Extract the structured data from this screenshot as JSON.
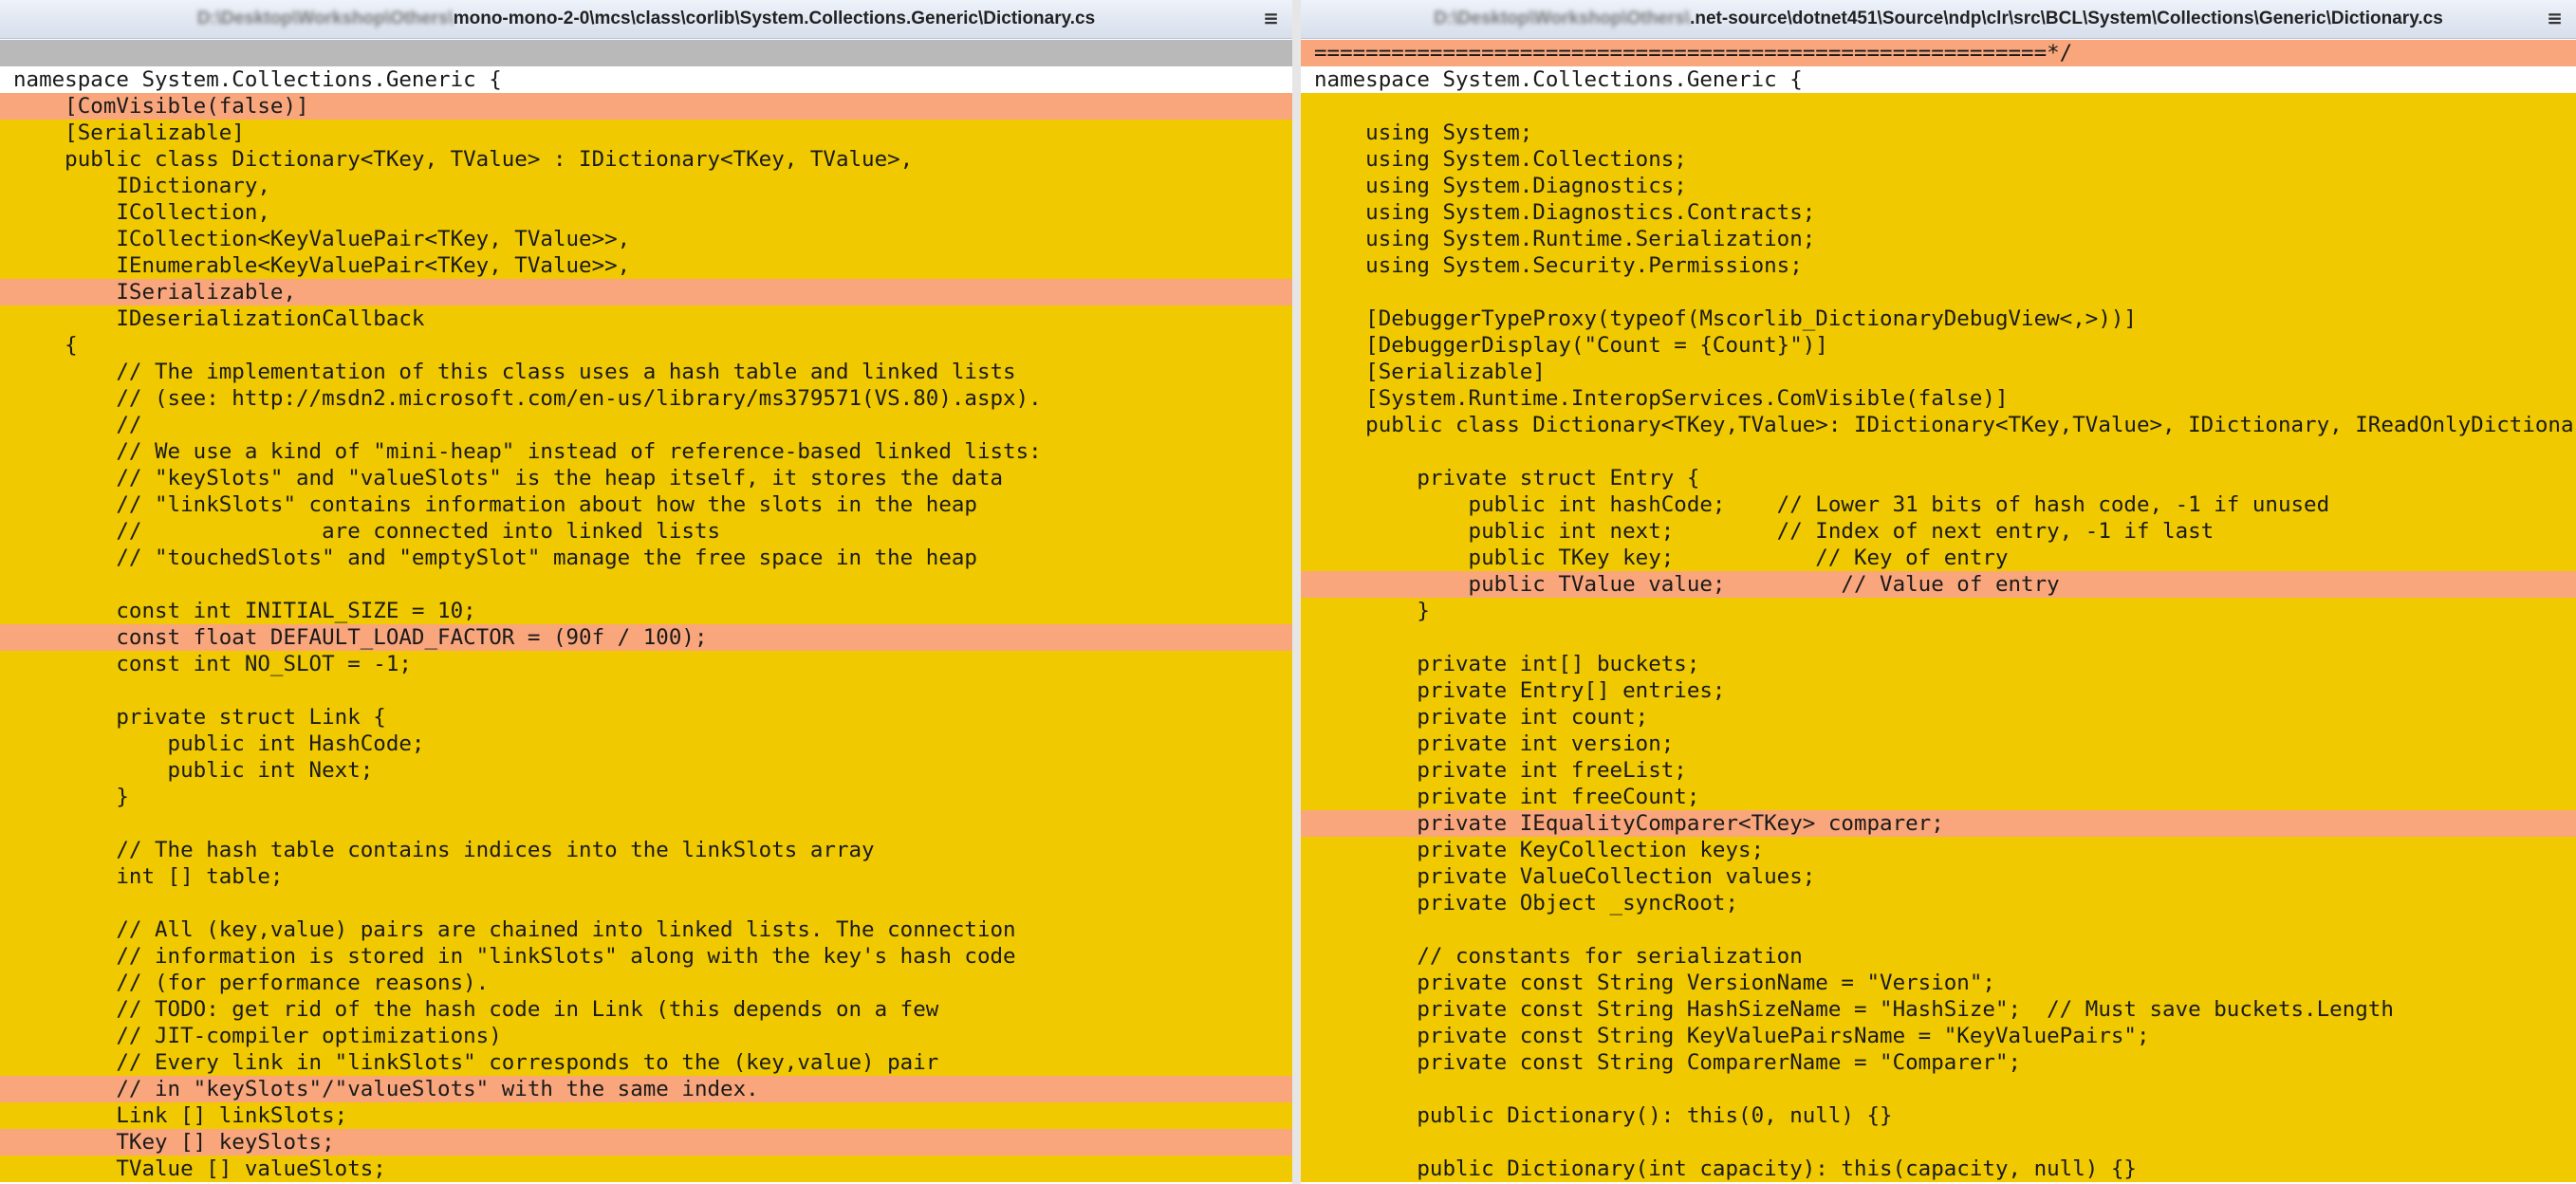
{
  "left": {
    "title_blur": "D:\\Desktop\\Workshop\\Others\\",
    "title_path": "mono-mono-2-0\\mcs\\class\\corlib\\System.Collections.Generic\\Dictionary.cs",
    "menu_icon": "hamburger-menu-icon",
    "lines": [
      {
        "t": "",
        "c": "g"
      },
      {
        "t": "namespace System.Collections.Generic {",
        "c": "w"
      },
      {
        "t": "    [ComVisible(false)]",
        "c": "r"
      },
      {
        "t": "    [Serializable]",
        "c": "y"
      },
      {
        "t": "    public class Dictionary<TKey, TValue> : IDictionary<TKey, TValue>,",
        "c": "y"
      },
      {
        "t": "        IDictionary,",
        "c": "y"
      },
      {
        "t": "        ICollection,",
        "c": "y"
      },
      {
        "t": "        ICollection<KeyValuePair<TKey, TValue>>,",
        "c": "y"
      },
      {
        "t": "        IEnumerable<KeyValuePair<TKey, TValue>>,",
        "c": "y"
      },
      {
        "t": "        ISerializable,",
        "c": "r"
      },
      {
        "t": "        IDeserializationCallback",
        "c": "y"
      },
      {
        "t": "    {",
        "c": "y"
      },
      {
        "t": "        // The implementation of this class uses a hash table and linked lists",
        "c": "y"
      },
      {
        "t": "        // (see: http://msdn2.microsoft.com/en-us/library/ms379571(VS.80).aspx).",
        "c": "y"
      },
      {
        "t": "        //",
        "c": "y"
      },
      {
        "t": "        // We use a kind of \"mini-heap\" instead of reference-based linked lists:",
        "c": "y"
      },
      {
        "t": "        // \"keySlots\" and \"valueSlots\" is the heap itself, it stores the data",
        "c": "y"
      },
      {
        "t": "        // \"linkSlots\" contains information about how the slots in the heap",
        "c": "y"
      },
      {
        "t": "        //              are connected into linked lists",
        "c": "y"
      },
      {
        "t": "        // \"touchedSlots\" and \"emptySlot\" manage the free space in the heap",
        "c": "y"
      },
      {
        "t": "",
        "c": "y"
      },
      {
        "t": "        const int INITIAL_SIZE = 10;",
        "c": "y"
      },
      {
        "t": "        const float DEFAULT_LOAD_FACTOR = (90f / 100);",
        "c": "r"
      },
      {
        "t": "        const int NO_SLOT = -1;",
        "c": "y"
      },
      {
        "t": "",
        "c": "y"
      },
      {
        "t": "        private struct Link {",
        "c": "y"
      },
      {
        "t": "            public int HashCode;",
        "c": "y"
      },
      {
        "t": "            public int Next;",
        "c": "y"
      },
      {
        "t": "        }",
        "c": "y"
      },
      {
        "t": "",
        "c": "y"
      },
      {
        "t": "        // The hash table contains indices into the linkSlots array",
        "c": "y"
      },
      {
        "t": "        int [] table;",
        "c": "y"
      },
      {
        "t": "",
        "c": "y"
      },
      {
        "t": "        // All (key,value) pairs are chained into linked lists. The connection",
        "c": "y"
      },
      {
        "t": "        // information is stored in \"linkSlots\" along with the key's hash code",
        "c": "y"
      },
      {
        "t": "        // (for performance reasons).",
        "c": "y"
      },
      {
        "t": "        // TODO: get rid of the hash code in Link (this depends on a few",
        "c": "y"
      },
      {
        "t": "        // JIT-compiler optimizations)",
        "c": "y"
      },
      {
        "t": "        // Every link in \"linkSlots\" corresponds to the (key,value) pair",
        "c": "y"
      },
      {
        "t": "        // in \"keySlots\"/\"valueSlots\" with the same index.",
        "c": "r"
      },
      {
        "t": "        Link [] linkSlots;",
        "c": "y"
      },
      {
        "t": "        TKey [] keySlots;",
        "c": "r"
      },
      {
        "t": "        TValue [] valueSlots;",
        "c": "y"
      }
    ]
  },
  "right": {
    "title_blur": "D:\\Desktop\\Workshop\\Others\\",
    "title_path": ".net-source\\dotnet451\\Source\\ndp\\clr\\src\\BCL\\System\\Collections\\Generic\\Dictionary.cs",
    "menu_icon": "hamburger-menu-icon",
    "lines": [
      {
        "t": "=========================================================*/",
        "c": "r"
      },
      {
        "t": "namespace System.Collections.Generic {",
        "c": "w"
      },
      {
        "t": "",
        "c": "y"
      },
      {
        "t": "    using System;",
        "c": "y"
      },
      {
        "t": "    using System.Collections;",
        "c": "y"
      },
      {
        "t": "    using System.Diagnostics;",
        "c": "y"
      },
      {
        "t": "    using System.Diagnostics.Contracts;",
        "c": "y"
      },
      {
        "t": "    using System.Runtime.Serialization;",
        "c": "y"
      },
      {
        "t": "    using System.Security.Permissions;",
        "c": "y"
      },
      {
        "t": "",
        "c": "y"
      },
      {
        "t": "    [DebuggerTypeProxy(typeof(Mscorlib_DictionaryDebugView<,>))]",
        "c": "y"
      },
      {
        "t": "    [DebuggerDisplay(\"Count = {Count}\")]",
        "c": "y"
      },
      {
        "t": "    [Serializable]",
        "c": "y"
      },
      {
        "t": "    [System.Runtime.InteropServices.ComVisible(false)]",
        "c": "y"
      },
      {
        "t": "    public class Dictionary<TKey,TValue>: IDictionary<TKey,TValue>, IDictionary, IReadOnlyDictionary<TKey,TValue>",
        "c": "y"
      },
      {
        "t": "",
        "c": "y"
      },
      {
        "t": "        private struct Entry {",
        "c": "y"
      },
      {
        "t": "            public int hashCode;    // Lower 31 bits of hash code, -1 if unused",
        "c": "y"
      },
      {
        "t": "            public int next;        // Index of next entry, -1 if last",
        "c": "y"
      },
      {
        "t": "            public TKey key;           // Key of entry",
        "c": "y"
      },
      {
        "t": "            public TValue value;         // Value of entry",
        "c": "r"
      },
      {
        "t": "        }",
        "c": "y"
      },
      {
        "t": "",
        "c": "y"
      },
      {
        "t": "        private int[] buckets;",
        "c": "y"
      },
      {
        "t": "        private Entry[] entries;",
        "c": "y"
      },
      {
        "t": "        private int count;",
        "c": "y"
      },
      {
        "t": "        private int version;",
        "c": "y"
      },
      {
        "t": "        private int freeList;",
        "c": "y"
      },
      {
        "t": "        private int freeCount;",
        "c": "y"
      },
      {
        "t": "        private IEqualityComparer<TKey> comparer;",
        "c": "r"
      },
      {
        "t": "        private KeyCollection keys;",
        "c": "y"
      },
      {
        "t": "        private ValueCollection values;",
        "c": "y"
      },
      {
        "t": "        private Object _syncRoot;",
        "c": "y"
      },
      {
        "t": "",
        "c": "y"
      },
      {
        "t": "        // constants for serialization",
        "c": "y"
      },
      {
        "t": "        private const String VersionName = \"Version\";",
        "c": "y"
      },
      {
        "t": "        private const String HashSizeName = \"HashSize\";  // Must save buckets.Length",
        "c": "y"
      },
      {
        "t": "        private const String KeyValuePairsName = \"KeyValuePairs\";",
        "c": "y"
      },
      {
        "t": "        private const String ComparerName = \"Comparer\";",
        "c": "y"
      },
      {
        "t": "",
        "c": "y"
      },
      {
        "t": "        public Dictionary(): this(0, null) {}",
        "c": "y"
      },
      {
        "t": "",
        "c": "y"
      },
      {
        "t": "        public Dictionary(int capacity): this(capacity, null) {}",
        "c": "y"
      }
    ]
  }
}
